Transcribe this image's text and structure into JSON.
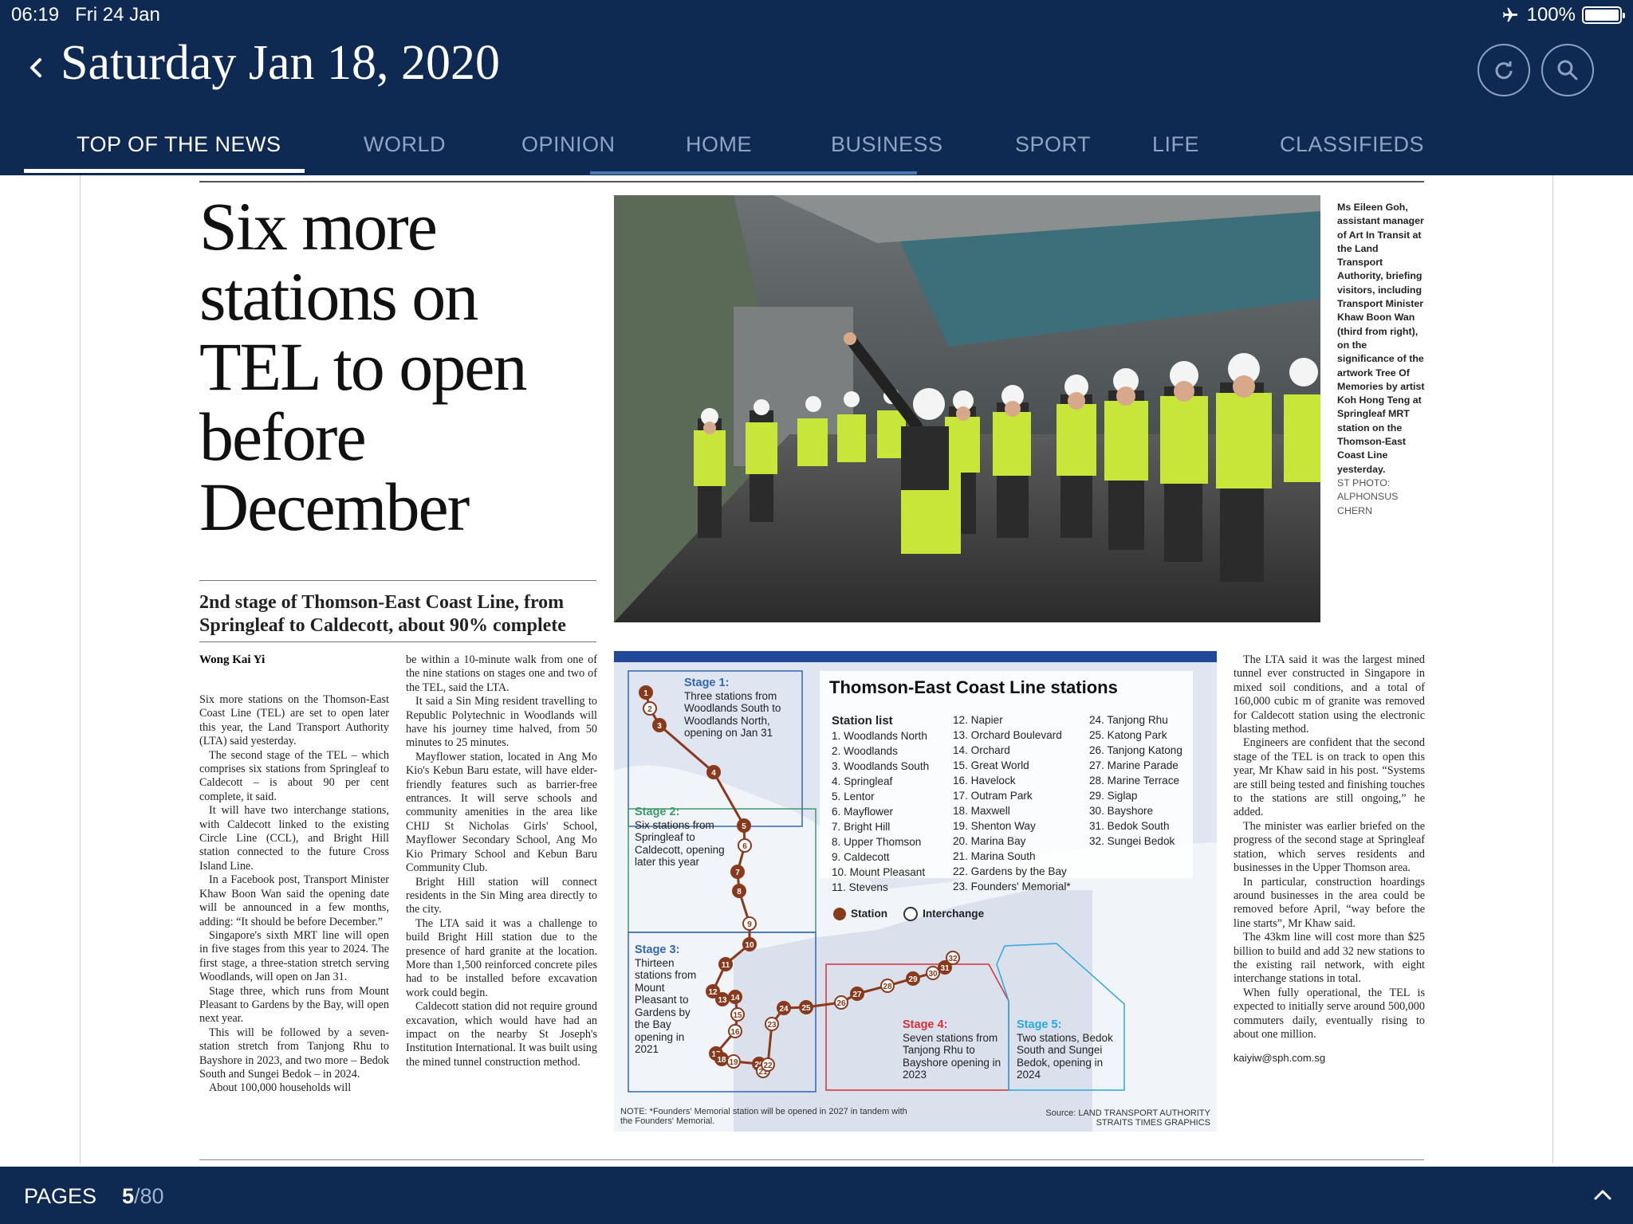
{
  "status": {
    "time": "06:19",
    "date": "Fri 24 Jan",
    "battery": "100%",
    "battery_level": 1.0
  },
  "header": {
    "title": "Saturday Jan 18, 2020"
  },
  "tabs": [
    "TOP OF THE NEWS",
    "WORLD",
    "OPINION",
    "HOME",
    "BUSINESS",
    "SPORT",
    "LIFE",
    "CLASSIFIEDS"
  ],
  "article": {
    "headline": "Six more stations on TEL to open before December",
    "dek": "2nd stage of Thomson-East Coast Line, from Springleaf to Caldecott, about 90% complete",
    "byline": "Wong Kai Yi",
    "col1": [
      "Six more stations on the Thomson-East Coast Line (TEL) are set to open later this year, the Land Transport Authority (LTA) said yesterday.",
      "The second stage of the TEL – which comprises six stations from Springleaf to Caldecott – is about 90 per cent complete, it said.",
      "It will have two interchange stations, with Caldecott linked to the existing Circle Line (CCL), and Bright Hill station connected to the future Cross Island Line.",
      "In a Facebook post, Transport Minister Khaw Boon Wan said the opening date will be announced in a few months, adding: “It should be before December.”",
      "Singapore's sixth MRT line will open in five stages from this year to 2024. The first stage, a three-station stretch serving Woodlands, will open on Jan 31.",
      "Stage three, which runs from Mount Pleasant to Gardens by the Bay, will open next year.",
      "This will be followed by a seven-station stretch from Tanjong Rhu to Bayshore in 2023, and two more – Bedok South and Sungei Bedok – in 2024.",
      "About 100,000 households will"
    ],
    "col2": [
      "be within a 10-minute walk from one of the nine stations on stages one and two of the TEL, said the LTA.",
      "It said a Sin Ming resident travelling to Republic Polytechnic in Woodlands will have his journey time halved, from 50 minutes to 25 minutes.",
      "Mayflower station, located in Ang Mo Kio's Kebun Baru estate, will have elder-friendly features such as barrier-free entrances. It will serve schools and community amenities in the area like CHIJ St Nicholas Girls' School, Mayflower Secondary School, Ang Mo Kio Primary School and Kebun Baru Community Club.",
      "Bright Hill station will connect residents in the Sin Ming area directly to the city.",
      "The LTA said it was a challenge to build Bright Hill station due to the presence of hard granite at the location. More than 1,500 reinforced concrete piles had to be installed before excavation work could begin.",
      "Caldecott station did not require ground excavation, which would have had an impact on the nearby St Joseph's Institution International. It was built using the mined tunnel construction method."
    ],
    "col3": [
      "The LTA said it was the largest mined tunnel ever constructed in Singapore in mixed soil conditions, and a total of 160,000 cubic m of granite was removed for Caldecott station using the electronic blasting method.",
      "Engineers are confident that the second stage of the TEL is on track to open this year, Mr Khaw said in his post. “Systems are still being tested and finishing touches to the stations are still ongoing,” he added.",
      "The minister was earlier briefed on the progress of the second stage at Springleaf station, which serves residents and businesses in the Upper Thomson area.",
      "In particular, construction hoardings around businesses in the area could be removed before April, “way before the line starts”, Mr Khaw said.",
      "The 43km line will cost more than $25 billion to build and add 32 new stations to the existing rail network, with eight interchange stations in total.",
      "When fully operational, the TEL is expected to initially serve around 500,000 commuters daily, eventually rising to about one million."
    ],
    "email": "kaiyiw@sph.com.sg",
    "caption": "Ms Eileen Goh, assistant manager of Art In Transit at the Land Transport Authority, briefing visitors, including Transport Minister Khaw Boon Wan (third from right), on the significance of the artwork Tree Of Memories by artist Koh Hong Teng at Springleaf MRT station on the Thomson-East Coast Line yesterday.",
    "credit": "ST PHOTO: ALPHONSUS CHERN"
  },
  "map": {
    "title": "Thomson-East Coast Line stations",
    "list_header": "Station list",
    "stations_a": [
      "1. Woodlands North",
      "2. Woodlands",
      "3. Woodlands South",
      "4. Springleaf",
      "5. Lentor",
      "6. Mayflower",
      "7. Bright Hill",
      "8. Upper Thomson",
      "9. Caldecott",
      "10. Mount Pleasant",
      "11. Stevens"
    ],
    "stations_b": [
      "12. Napier",
      "13. Orchard Boulevard",
      "14. Orchard",
      "15. Great World",
      "16. Havelock",
      "17. Outram Park",
      "18. Maxwell",
      "19. Shenton Way",
      "20. Marina Bay",
      "21. Marina South",
      "22. Gardens by the Bay",
      "23. Founders' Memorial*"
    ],
    "stations_c": [
      "24. Tanjong Rhu",
      "25. Katong Park",
      "26. Tanjong Katong",
      "27. Marine Parade",
      "28. Marine Terrace",
      "29. Siglap",
      "30. Bayshore",
      "31. Bedok South",
      "32. Sungei Bedok"
    ],
    "legend_station": "Station",
    "legend_interchange": "Interchange",
    "stage1_title": "Stage 1:",
    "stage1_text": "Three stations from Woodlands South to Woodlands North, opening on Jan 31",
    "stage2_title": "Stage 2:",
    "stage2_text": "Six stations from Springleaf to Caldecott, opening later this year",
    "stage3_title": "Stage 3:",
    "stage3_text": "Thirteen stations from Mount Pleasant to Gardens by the Bay opening in 2021",
    "stage4_title": "Stage 4:",
    "stage4_text": "Seven stations from Tanjong Rhu to Bayshore opening in 2023",
    "stage5_title": "Stage 5:",
    "stage5_text": "Two stations, Bedok South and Sungei Bedok, opening in 2024",
    "note": "NOTE: *Founders' Memorial station will be opened in 2027 in tandem with the Founders' Memorial.",
    "source": "Source: LAND TRANSPORT AUTHORITY STRAITS TIMES GRAPHICS",
    "colors": {
      "line": "#8a3a1c",
      "stage1": "#3566b0",
      "stage2": "#3f9a6a",
      "stage3": "#3566b0",
      "stage4": "#d6303a",
      "stage5": "#2aa8df"
    },
    "station_numbers": [
      "1",
      "2",
      "3",
      "4",
      "5",
      "6",
      "7",
      "8",
      "9",
      "10",
      "11",
      "12",
      "13",
      "14",
      "15",
      "16",
      "17",
      "18",
      "19",
      "20",
      "21",
      "22",
      "23",
      "24",
      "25",
      "26",
      "27",
      "28",
      "29",
      "30",
      "31",
      "32"
    ]
  },
  "footer": {
    "pages_label": "PAGES",
    "current_page": "5",
    "total_pages": "/80"
  },
  "colors": {
    "nav_bg": "#0f2a52",
    "tab_inactive": "#8fa3c2"
  }
}
